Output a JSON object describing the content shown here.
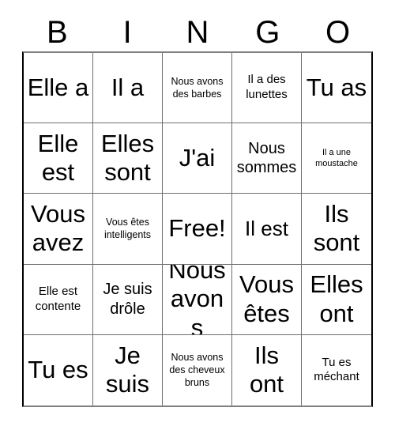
{
  "card": {
    "title": "BINGO",
    "header_letters": [
      "B",
      "I",
      "N",
      "G",
      "O"
    ],
    "free_space_label": "Free!",
    "grid_size": "5x5",
    "colors": {
      "background": "#ffffff",
      "text": "#000000",
      "cell_border": "#6e6e6e",
      "outer_border": "#000000"
    },
    "cells": [
      {
        "text": "Elle a",
        "size": "xl"
      },
      {
        "text": "Il a",
        "size": "xl"
      },
      {
        "text": "Nous avons des barbes",
        "size": "xs"
      },
      {
        "text": "Il a des lunettes",
        "size": "sm"
      },
      {
        "text": "Tu as",
        "size": "xl"
      },
      {
        "text": "Elle est",
        "size": "xl"
      },
      {
        "text": "Elles sont",
        "size": "xl"
      },
      {
        "text": "J'ai",
        "size": "xl"
      },
      {
        "text": "Nous sommes",
        "size": "md"
      },
      {
        "text": "Il a une moustache",
        "size": "xxs"
      },
      {
        "text": "Vous avez",
        "size": "xl"
      },
      {
        "text": "Vous êtes intelligents",
        "size": "xs"
      },
      {
        "text": "Free!",
        "size": "xl"
      },
      {
        "text": "Il est",
        "size": "lg"
      },
      {
        "text": "Ils sont",
        "size": "xl"
      },
      {
        "text": "Elle est contente",
        "size": "sm"
      },
      {
        "text": "Je suis drôle",
        "size": "md"
      },
      {
        "text": "Nous avons",
        "size": "xl"
      },
      {
        "text": "Vous êtes",
        "size": "xl"
      },
      {
        "text": "Elles ont",
        "size": "xl"
      },
      {
        "text": "Tu es",
        "size": "xl"
      },
      {
        "text": "Je suis",
        "size": "xl"
      },
      {
        "text": "Nous avons des cheveux bruns",
        "size": "xs"
      },
      {
        "text": "Ils ont",
        "size": "xl"
      },
      {
        "text": "Tu es méchant",
        "size": "sm"
      }
    ]
  }
}
